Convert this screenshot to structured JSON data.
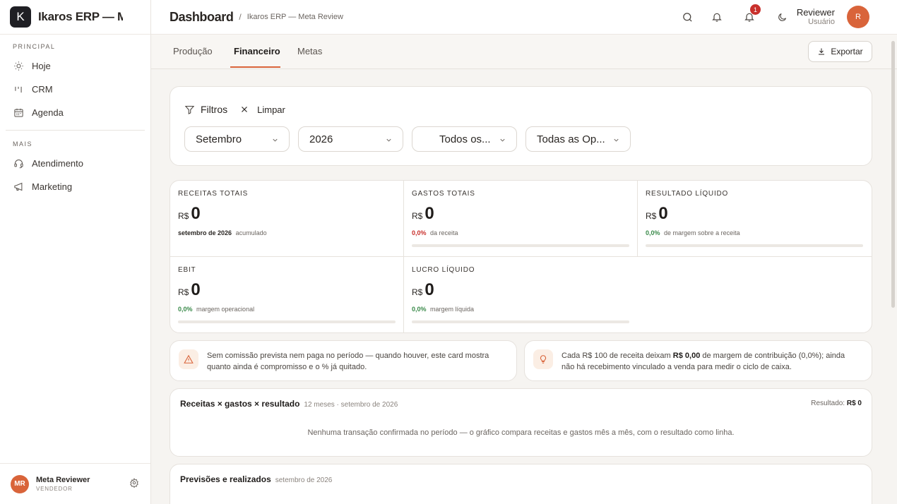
{
  "brand": {
    "logo_letter": "K",
    "name": "Ikaros ERP — M"
  },
  "sidebar": {
    "sections": [
      {
        "label": "PRINCIPAL",
        "items": [
          {
            "label": "Hoje",
            "icon": "sun-icon"
          },
          {
            "label": "CRM",
            "icon": "kanban-icon"
          },
          {
            "label": "Agenda",
            "icon": "calendar-icon"
          }
        ]
      },
      {
        "label": "MAIS",
        "items": [
          {
            "label": "Atendimento",
            "icon": "headset-icon"
          },
          {
            "label": "Marketing",
            "icon": "megaphone-icon"
          }
        ]
      }
    ],
    "user": {
      "initials": "MR",
      "name": "Meta Reviewer",
      "role": "VENDEDOR"
    }
  },
  "header": {
    "title": "Dashboard",
    "separator": "/",
    "breadcrumb": "Ikaros ERP — Meta Review",
    "notifications_count": "1",
    "user_name": "Reviewer",
    "user_role": "Usuário",
    "user_initial": "R"
  },
  "tabs": [
    {
      "label": "Produção",
      "active": false
    },
    {
      "label": "Financeiro",
      "active": true
    },
    {
      "label": "Metas",
      "active": false
    }
  ],
  "export_label": "Exportar",
  "filters": {
    "title": "Filtros",
    "clear_label": "Limpar",
    "month": "Setembro",
    "year": "2026",
    "select3": "Todos os...",
    "select4": "Todas as Op..."
  },
  "kpis": [
    {
      "label": "RECEITAS TOTAIS",
      "currency": "R$",
      "value": "0",
      "sub_strong": "setembro de 2026",
      "sub": "acumulado",
      "progress": 0
    },
    {
      "label": "GASTOS TOTAIS",
      "currency": "R$",
      "value": "0",
      "sub_pct": "0,0%",
      "sub": "da receita",
      "progress": 0
    },
    {
      "label": "RESULTADO LÍQUIDO",
      "currency": "R$",
      "value": "0",
      "sub_pct": "0,0%",
      "sub": "de margem sobre a receita",
      "progress": 0
    },
    {
      "label": "EBIT",
      "currency": "R$",
      "value": "0",
      "sub_pct": "0,0%",
      "sub": "margem operacional",
      "progress": 0
    },
    {
      "label": "LUCRO LÍQUIDO",
      "currency": "R$",
      "value": "0",
      "sub_pct": "0,0%",
      "sub": "margem líquida",
      "progress": 0
    }
  ],
  "notes": {
    "left": {
      "line1": "Sem comissão prevista nem paga no período — quando houver, este card mostra",
      "line2": "quanto ainda é compromisso e o % já quitado."
    },
    "right": {
      "line1_a": "Cada R$ 100 de receita deixam",
      "line1_bold": "R$ 0,00",
      "line1_b": "de margem de contribuição (0,0%); ainda",
      "line2": "não há recebimento vinculado a venda para medir o ciclo de caixa."
    }
  },
  "chart_card": {
    "title": "Receitas × gastos × resultado",
    "subtitle": "12 meses · setembro de 2026",
    "result_label": "Resultado:",
    "result_value": "R$ 0",
    "empty_message": "Nenhuma transação confirmada no período — o gráfico compara receitas e gastos mês a mês, com o resultado como linha."
  },
  "forecast_card": {
    "title": "Previsões e realizados",
    "subtitle": "setembro de 2026"
  }
}
